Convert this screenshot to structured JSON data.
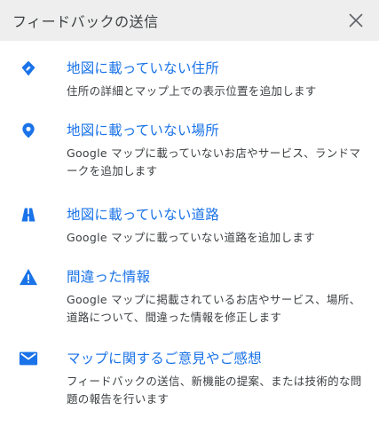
{
  "header": {
    "title": "フィードバックの送信",
    "close_icon": "close-icon"
  },
  "accent_color": "#1a73e8",
  "items": [
    {
      "icon": "location-edit-icon",
      "title": "地図に載っていない住所",
      "description": "住所の詳細とマップ上での表示位置を追加します"
    },
    {
      "icon": "place-pin-icon",
      "title": "地図に載っていない場所",
      "description": "Google マップに載っていないお店やサービス、ランドマークを追加します"
    },
    {
      "icon": "road-icon",
      "title": "地図に載っていない道路",
      "description": "Google マップに載っていない道路を追加します"
    },
    {
      "icon": "warning-icon",
      "title": "間違った情報",
      "description": "Google マップに掲載されているお店やサービス、場所、道路について、間違った情報を修正します"
    },
    {
      "icon": "mail-icon",
      "title": "マップに関するご意見やご感想",
      "description": "フィードバックの送信、新機能の提案、または技術的な問題の報告を行います"
    }
  ]
}
